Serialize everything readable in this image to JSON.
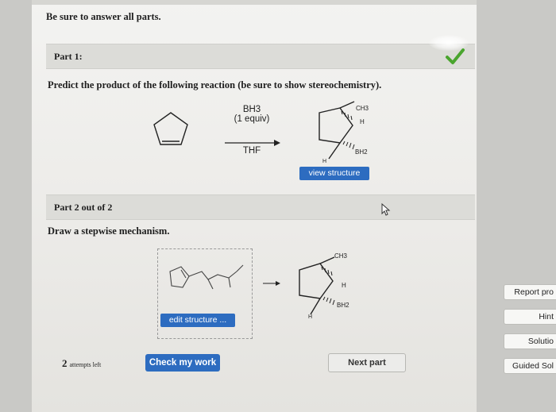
{
  "instructions": "Be sure to answer all parts.",
  "part1": {
    "label": "Part 1:",
    "prompt": "Predict the product of the following reaction (be sure to show stereochemistry).",
    "reagents": {
      "line1": "BH3",
      "line2": "(1 equiv)",
      "line3": "THF"
    },
    "product_labels": {
      "ch3": "CH3",
      "h_top": "H",
      "bh2": "BH2",
      "h_bottom": "H"
    },
    "view_button": "view structure"
  },
  "part2": {
    "label": "Part 2 out of 2",
    "prompt": "Draw a stepwise mechanism.",
    "product_labels": {
      "ch3": "CH3",
      "h_top": "H",
      "bh2": "BH2",
      "h_bottom": "H"
    },
    "edit_button": "edit structure ..."
  },
  "footer": {
    "attempts_count": "2",
    "attempts_text": "attempts left",
    "check_button": "Check my work",
    "next_button": "Next part"
  },
  "sidebar": {
    "report": "Report pro",
    "hint": "Hint",
    "solution": "Solutio",
    "guided": "Guided Sol"
  },
  "colors": {
    "accent_blue": "#2d6cc0",
    "check_green": "#4aa52e"
  }
}
